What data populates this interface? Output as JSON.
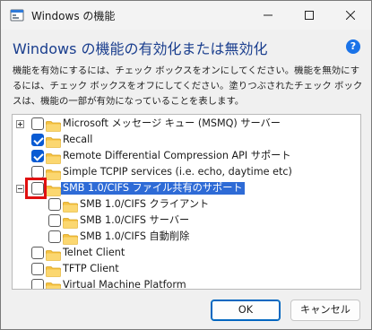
{
  "window": {
    "title": "Windows の機能",
    "heading": "Windows の機能の有効化または無効化",
    "description": "機能を有効にするには、チェック ボックスをオンにしてください。機能を無効にするには、チェック ボックスをオフにしてください。塗りつぶされたチェック ボックスは、機能の一部が有効になっていることを表します。"
  },
  "features": [
    {
      "label": "Microsoft メッセージ キュー (MSMQ) サーバー",
      "checked": false,
      "expander": "plus",
      "level": 0
    },
    {
      "label": "Recall",
      "checked": true,
      "expander": "none",
      "level": 0
    },
    {
      "label": "Remote Differential Compression API サポート",
      "checked": true,
      "expander": "none",
      "level": 0
    },
    {
      "label": "Simple TCPIP services (i.e. echo, daytime etc)",
      "checked": false,
      "expander": "none",
      "level": 0
    },
    {
      "label": "SMB 1.0/CIFS ファイル共有のサポート",
      "checked": false,
      "expander": "minus",
      "level": 0,
      "selected": true
    },
    {
      "label": "SMB 1.0/CIFS クライアント",
      "checked": false,
      "expander": "none",
      "level": 1
    },
    {
      "label": "SMB 1.0/CIFS サーバー",
      "checked": false,
      "expander": "none",
      "level": 1
    },
    {
      "label": "SMB 1.0/CIFS 自動削除",
      "checked": false,
      "expander": "none",
      "level": 1
    },
    {
      "label": "Telnet Client",
      "checked": false,
      "expander": "none",
      "level": 0
    },
    {
      "label": "TFTP Client",
      "checked": false,
      "expander": "none",
      "level": 0
    },
    {
      "label": "Virtual Machine Platform",
      "checked": false,
      "expander": "none",
      "level": 0
    }
  ],
  "buttons": {
    "ok": "OK",
    "cancel": "キャンセル"
  },
  "icons": {
    "help": "?",
    "folder": "folder-icon",
    "app": "windows-features-icon"
  },
  "colors": {
    "accent": "#0a5bd3",
    "heading": "#1a3e8e",
    "selection": "#2e6bd6",
    "highlight": "#e01010",
    "folder": "#f5c242"
  }
}
